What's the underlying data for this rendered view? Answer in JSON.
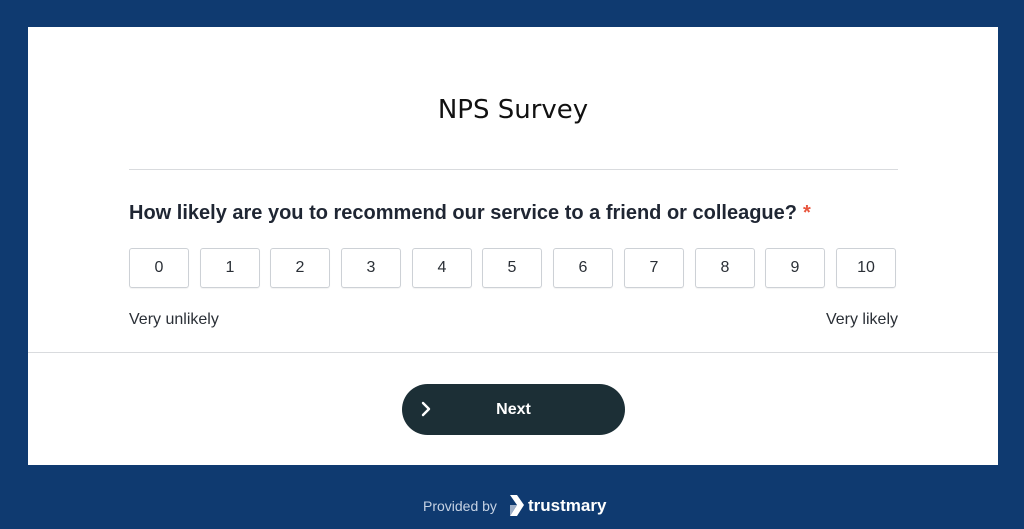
{
  "survey": {
    "title": "NPS Survey",
    "question": "How likely are you to recommend our service to a friend or colleague?",
    "required_mark": "*",
    "scale": [
      "0",
      "1",
      "2",
      "3",
      "4",
      "5",
      "6",
      "7",
      "8",
      "9",
      "10"
    ],
    "low_label": "Very unlikely",
    "high_label": "Very likely"
  },
  "actions": {
    "next_label": "Next",
    "next_icon": "chevron-right-icon"
  },
  "footer": {
    "provided_by": "Provided by",
    "brand_name": "trustmary",
    "brand_icon": "trustmary-logo-icon"
  },
  "colors": {
    "page_background": "#0f3a70",
    "card_background": "#ffffff",
    "button_background": "#1c2f36",
    "required_accent": "#e8553d"
  }
}
